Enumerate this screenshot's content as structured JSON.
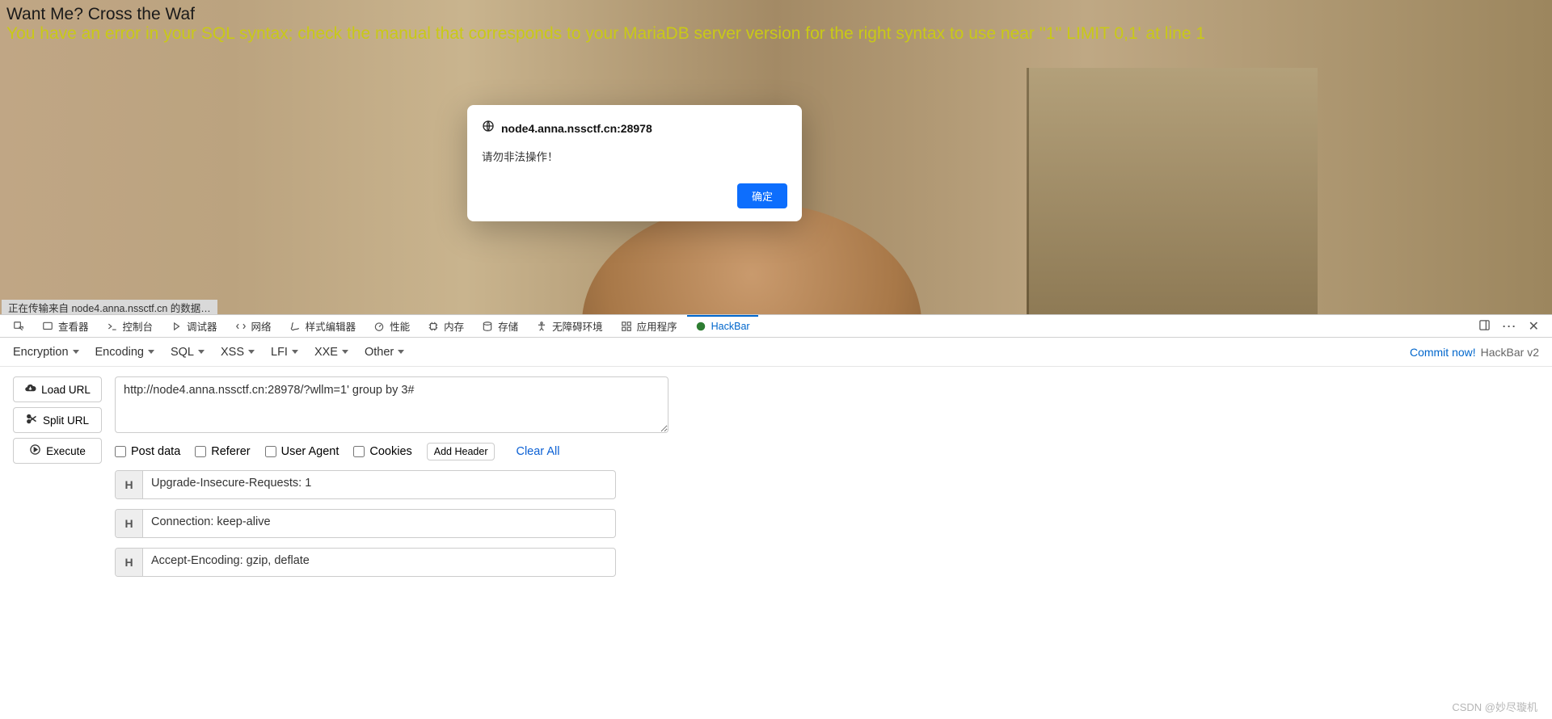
{
  "page": {
    "title": "Want Me? Cross the Waf",
    "sql_error": "You have an error in your SQL syntax; check the manual that corresponds to your MariaDB server version for the right syntax to use near ''1'' LIMIT 0,1' at line 1",
    "status_text": "正在传输来自 node4.anna.nssctf.cn 的数据…"
  },
  "dialog": {
    "host": "node4.anna.nssctf.cn:28978",
    "message": "请勿非法操作！",
    "ok": "确定"
  },
  "devtools": {
    "tabs": [
      "查看器",
      "控制台",
      "调试器",
      "网络",
      "样式编辑器",
      "性能",
      "内存",
      "存储",
      "无障碍环境",
      "应用程序",
      "HackBar"
    ],
    "active_tab": "HackBar"
  },
  "hackbar": {
    "dropdowns": [
      "Encryption",
      "Encoding",
      "SQL",
      "XSS",
      "LFI",
      "XXE",
      "Other"
    ],
    "right_link": "Commit now!",
    "right_text": "HackBar v2",
    "buttons": {
      "load": "Load URL",
      "split": "Split URL",
      "exec": "Execute"
    },
    "url_value": "http://node4.anna.nssctf.cn:28978/?wllm=1' group by 3#",
    "checks": [
      "Post data",
      "Referer",
      "User Agent",
      "Cookies"
    ],
    "add_header": "Add Header",
    "clear_all": "Clear All",
    "headers": [
      "Upgrade-Insecure-Requests: 1",
      "Connection: keep-alive",
      "Accept-Encoding: gzip, deflate"
    ]
  },
  "watermark": "CSDN @妙尽璇机"
}
